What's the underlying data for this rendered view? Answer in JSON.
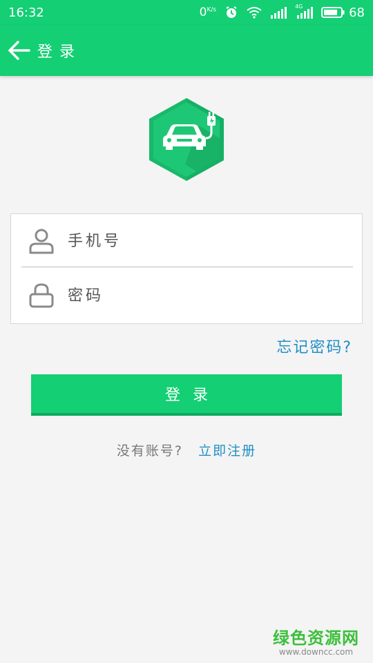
{
  "statusbar": {
    "time": "16:32",
    "netspeed": "0",
    "netspeed_unit": "K/s",
    "network_label": "4G",
    "battery": "68"
  },
  "toolbar": {
    "title": "登录"
  },
  "form": {
    "phone_placeholder": "手机号",
    "password_placeholder": "密码",
    "forgot_label": "忘记密码?"
  },
  "login_button": "登录",
  "register": {
    "prompt": "没有账号?",
    "link": "立即注册"
  },
  "watermark": {
    "name": "绿色资源网",
    "url": "www.downcc.com"
  },
  "colors": {
    "brand_green": "#14cf74",
    "link_blue": "#1f8fc5",
    "logo_green": "#1aae66"
  }
}
